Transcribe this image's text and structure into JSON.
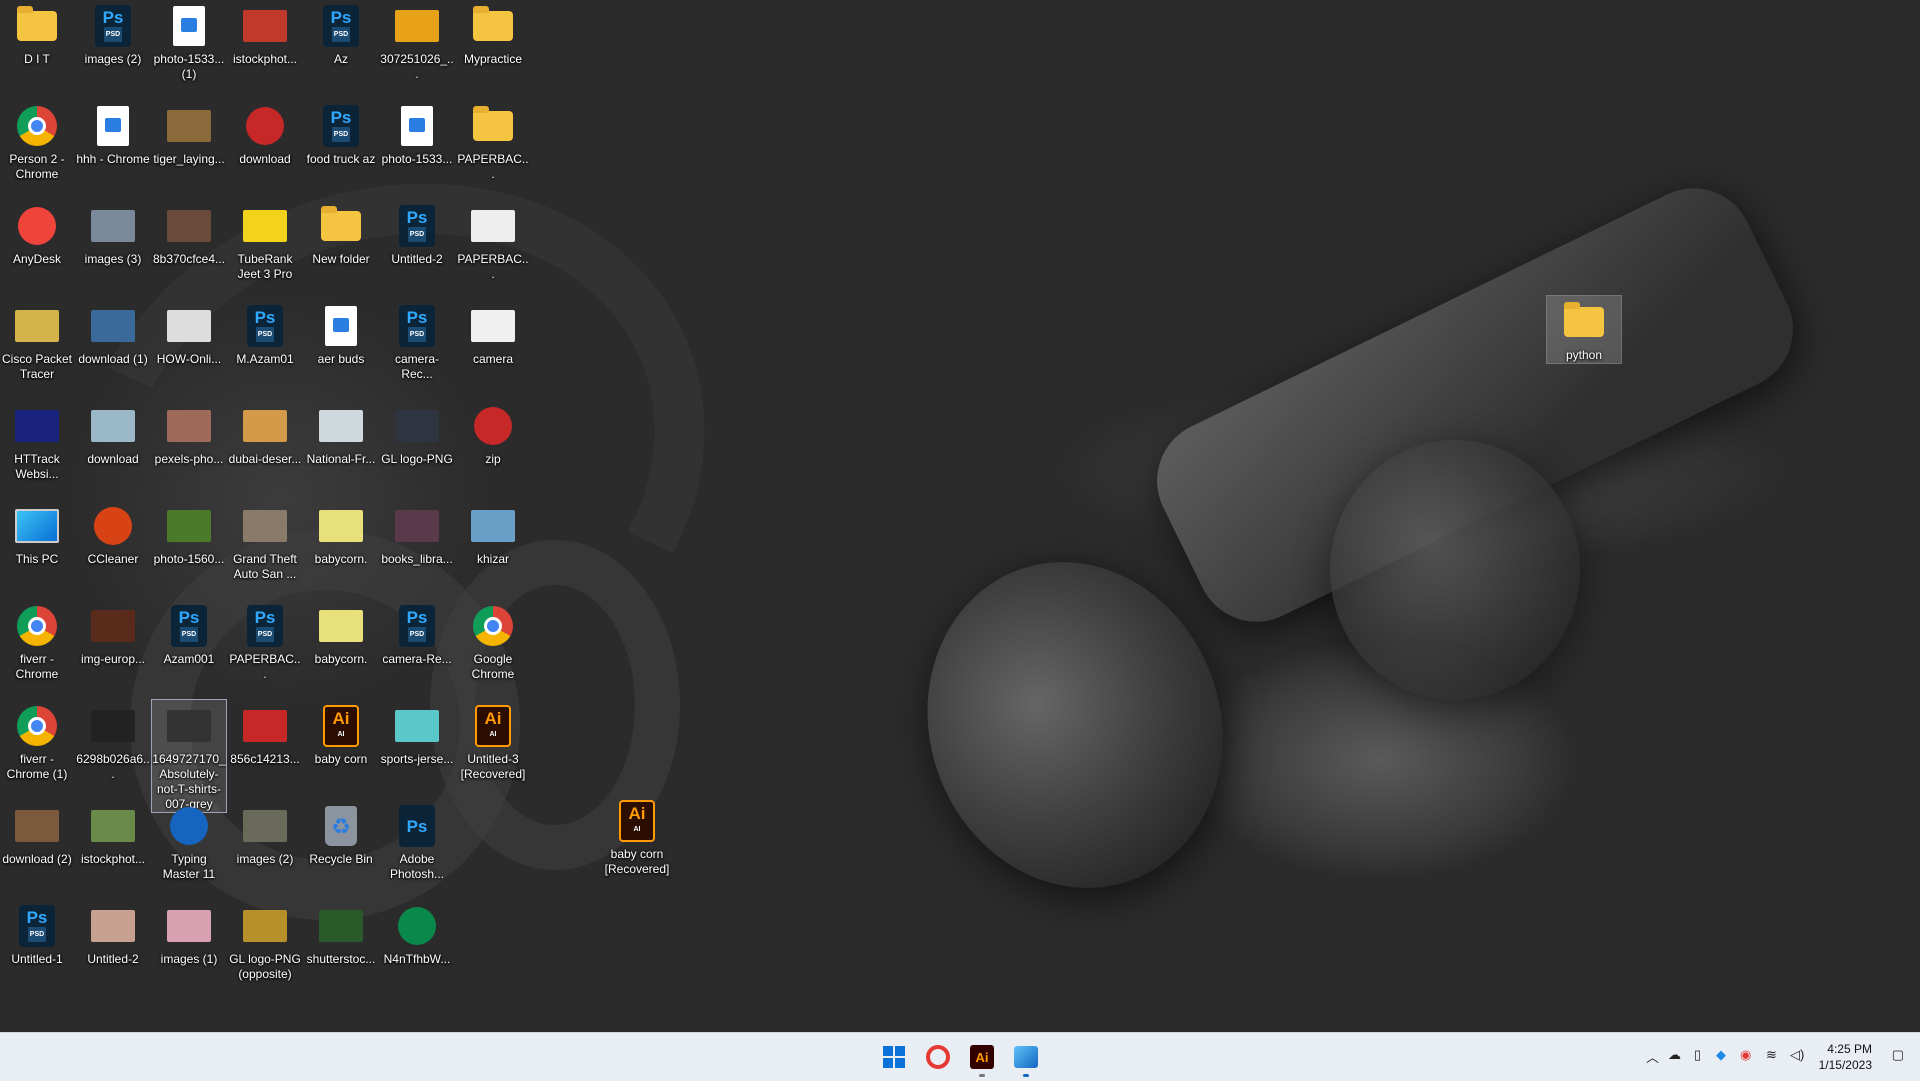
{
  "desktop": {
    "icons": [
      {
        "label": "D I T",
        "type": "folder"
      },
      {
        "label": "images (2)",
        "type": "ps",
        "sub": "PSD"
      },
      {
        "label": "photo-1533... (1)",
        "type": "doc"
      },
      {
        "label": "istockphot...",
        "type": "photo",
        "color": "#c0392b"
      },
      {
        "label": "Az",
        "type": "ps",
        "sub": "PSD"
      },
      {
        "label": "307251026_...",
        "type": "photo",
        "color": "#e8a21a"
      },
      {
        "label": "Mypractice",
        "type": "folder"
      },
      {
        "label": "Person 2 - Chrome",
        "type": "chrome"
      },
      {
        "label": "hhh - Chrome",
        "type": "doc"
      },
      {
        "label": "tiger_laying...",
        "type": "photo",
        "color": "#8a6a3a"
      },
      {
        "label": "download",
        "type": "circ",
        "color": "#c62828"
      },
      {
        "label": "food truck az",
        "type": "ps",
        "sub": "PSD"
      },
      {
        "label": "photo-1533...",
        "type": "doc"
      },
      {
        "label": "PAPERBAC...",
        "type": "folder"
      },
      {
        "label": "AnyDesk",
        "type": "circ",
        "color": "#ef443b"
      },
      {
        "label": "images (3)",
        "type": "photo",
        "color": "#7a8a9a"
      },
      {
        "label": "8b370cfce4...",
        "type": "photo",
        "color": "#6a4a3a"
      },
      {
        "label": "TubeRank Jeet 3 Pro",
        "type": "photo",
        "color": "#f2d21b"
      },
      {
        "label": "New folder",
        "type": "folder"
      },
      {
        "label": "Untitled-2",
        "type": "ps",
        "sub": "PSD"
      },
      {
        "label": "PAPERBAC...",
        "type": "photo",
        "color": "#eeeeee"
      },
      {
        "label": "Cisco Packet Tracer",
        "type": "photo",
        "color": "#d4b44a"
      },
      {
        "label": "download (1)",
        "type": "photo",
        "color": "#3a6a9a"
      },
      {
        "label": "HOW-Onli...",
        "type": "photo",
        "color": "#dddddd"
      },
      {
        "label": "M.Azam01",
        "type": "ps",
        "sub": "PSD"
      },
      {
        "label": "aer buds",
        "type": "doc"
      },
      {
        "label": "camera-Rec...",
        "type": "ps",
        "sub": "PSD"
      },
      {
        "label": "camera",
        "type": "photo",
        "color": "#f0f0f0"
      },
      {
        "label": "HTTrack Websi...",
        "type": "photo",
        "color": "#1a237e"
      },
      {
        "label": "download",
        "type": "photo",
        "color": "#9ab8c8"
      },
      {
        "label": "pexels-pho...",
        "type": "photo",
        "color": "#a06a5a"
      },
      {
        "label": "dubai-deser...",
        "type": "photo",
        "color": "#d39a4a"
      },
      {
        "label": "National-Fr...",
        "type": "photo",
        "color": "#cfd8dc"
      },
      {
        "label": "GL logo-PNG",
        "type": "photo",
        "color": "#2e3440"
      },
      {
        "label": "zip",
        "type": "circ",
        "color": "#c62828"
      },
      {
        "label": "This PC",
        "type": "monitor"
      },
      {
        "label": "CCleaner",
        "type": "circ",
        "color": "#d84315"
      },
      {
        "label": "photo-1560...",
        "type": "photo",
        "color": "#4a7a2a"
      },
      {
        "label": "Grand Theft Auto San ...",
        "type": "photo",
        "color": "#8a7a6a"
      },
      {
        "label": "babycorn.",
        "type": "photo",
        "color": "#e8e07a"
      },
      {
        "label": "books_libra...",
        "type": "photo",
        "color": "#5a3a4a"
      },
      {
        "label": "khizar",
        "type": "photo",
        "color": "#6aa0c8"
      },
      {
        "label": "fiverr - Chrome",
        "type": "chrome"
      },
      {
        "label": "img-europ...",
        "type": "photo",
        "color": "#5a2a1a"
      },
      {
        "label": "Azam001",
        "type": "ps",
        "sub": "PSD"
      },
      {
        "label": "PAPERBAC...",
        "type": "ps",
        "sub": "PSD"
      },
      {
        "label": "babycorn.",
        "type": "photo",
        "color": "#e8e07a"
      },
      {
        "label": "camera-Re...",
        "type": "ps",
        "sub": "PSD"
      },
      {
        "label": "Google Chrome",
        "type": "chrome"
      },
      {
        "label": "fiverr - Chrome (1)",
        "type": "chrome"
      },
      {
        "label": "6298b026a6...",
        "type": "photo",
        "color": "#222222"
      },
      {
        "label": "1649727170_Absolutely-not-T-shirts-007-grey",
        "type": "photo",
        "color": "#333333"
      },
      {
        "label": "856c14213...",
        "type": "photo",
        "color": "#c62828"
      },
      {
        "label": "baby corn",
        "type": "ai",
        "sub": "AI"
      },
      {
        "label": "sports-jerse...",
        "type": "photo",
        "color": "#5ac8c8"
      },
      {
        "label": "Untitled-3 [Recovered]",
        "type": "ai",
        "sub": "AI"
      },
      {
        "label": "download (2)",
        "type": "photo",
        "color": "#7a5a3a"
      },
      {
        "label": "istockphot...",
        "type": "photo",
        "color": "#6a8a4a"
      },
      {
        "label": "Typing Master 11",
        "type": "circ",
        "color": "#1565c0"
      },
      {
        "label": "images (2)",
        "type": "photo",
        "color": "#6a6a5a"
      },
      {
        "label": "Recycle Bin",
        "type": "recycle"
      },
      {
        "label": "Adobe Photosh...",
        "type": "ps",
        "sub": ""
      },
      {
        "label": "",
        "type": "none"
      },
      {
        "label": "Untitled-1",
        "type": "ps",
        "sub": "PSD"
      },
      {
        "label": "Untitled-2",
        "type": "photo",
        "color": "#c8a090"
      },
      {
        "label": "images (1)",
        "type": "photo",
        "color": "#d8a0b0"
      },
      {
        "label": "GL logo-PNG (opposite)",
        "type": "photo",
        "color": "#b8902a"
      },
      {
        "label": "shutterstoc...",
        "type": "photo",
        "color": "#2a5a2a"
      },
      {
        "label": "N4nTfhbW...",
        "type": "circ",
        "color": "#0a8a4a"
      }
    ],
    "extra_icons": {
      "baby_corn_recovered": {
        "label": "baby corn [Recovered]",
        "type": "ai",
        "sub": "AI"
      },
      "python": {
        "label": "python",
        "type": "folder"
      }
    }
  },
  "taskbar": {
    "apps": [
      "Start",
      "Opera",
      "Adobe Illustrator",
      "Photos"
    ],
    "ps_letters": "Ps",
    "ai_letters": "Ai",
    "time": "4:25 PM",
    "date": "1/15/2023"
  }
}
